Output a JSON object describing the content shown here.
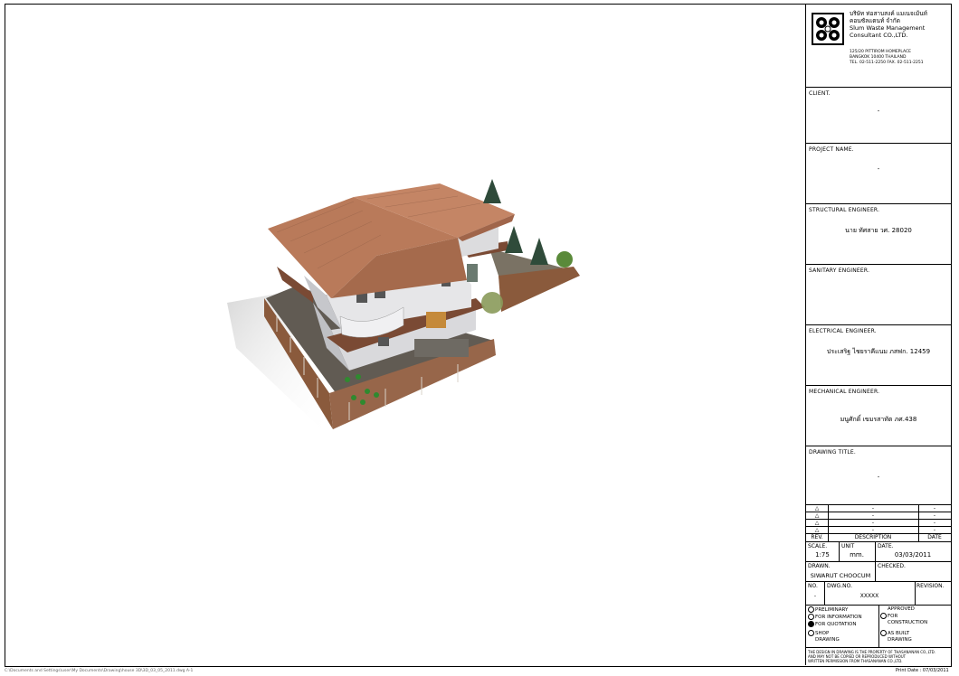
{
  "company": {
    "name_th": "บริษัท ท่อสาบสงค์ แมเนจเม้นท์",
    "name_th2": "คอนซัลแตนท์ จำกัด",
    "name_en1": "Slum Waste Management",
    "name_en2": "Consultant CO.,LTD.",
    "addr1": "125/20 PITTIROM HOMEPLACE",
    "addr2": "BANGKOK 10400 THAILAND",
    "tel": "TEL. 02-511-2250",
    "fax": "FAX. 02-511-2251"
  },
  "client": {
    "label": "CLIENT.",
    "value": "-"
  },
  "project": {
    "label": "PROJECT NAME.",
    "value": "-"
  },
  "structural": {
    "label": "STRUCTURAL ENGINEER.",
    "value": "นาย  ทัศสาย  วศ. 28020"
  },
  "sanitary": {
    "label": "SANITARY ENGINEER.",
    "value": ""
  },
  "electrical": {
    "label": "ELECTRICAL ENGINEER.",
    "value": "ประเสริฐ  ไชยราคีแนม  ภสฟก. 12459"
  },
  "mechanical": {
    "label": "MECHANICAL ENGINEER.",
    "value": "มนูศักดิ์  เขมรสาทัต  ภศ.438"
  },
  "drawing_title": {
    "label": "DRAWING TITLE.",
    "value": "-"
  },
  "revisions": [
    {
      "mark": "△",
      "desc": "-",
      "date": "-"
    },
    {
      "mark": "△",
      "desc": "-",
      "date": "-"
    },
    {
      "mark": "△",
      "desc": "-",
      "date": "-"
    },
    {
      "mark": "△",
      "desc": "-",
      "date": "-"
    }
  ],
  "rev_header": {
    "rev": "REV.",
    "desc": "DESCRIPTION",
    "date": "DATE"
  },
  "scale": {
    "label": "SCALE.",
    "value": "1:75"
  },
  "unit": {
    "label": "UNIT",
    "value": "mm."
  },
  "date": {
    "label": "DATE.",
    "value": "03/03/2011"
  },
  "drawn": {
    "label": "DRAWN.",
    "value": "SIWARUT CHOOCUM"
  },
  "checked": {
    "label": "CHECKED.",
    "value": ""
  },
  "no": {
    "label": "NO.",
    "value": "-"
  },
  "dwg_no": {
    "label": "DWG.NO.",
    "value": "XXXXX"
  },
  "revision": {
    "label": "REVISION.",
    "value": ""
  },
  "status": {
    "preliminary": "PRELIMINARY",
    "for_information": "FOR INFORMATION",
    "for_quotation": "FOR QUOTATION",
    "shop_drawing_1": "SHOP",
    "shop_drawing_2": "DRAWING",
    "approved_1": "APPROVED",
    "approved_2": "FOR",
    "approved_3": "CONSTRUCTION",
    "as_built_1": "AS BUILT",
    "as_built_2": "DRAWING"
  },
  "notice1": "THE DESIGN IN DRAWING IS THE PROPERTY OF THASANANAN CO.,LTD.",
  "notice2": "AND MAY NOT BE COPIED OR REPRODUCED WITHOUT",
  "notice3": "WRITTEN PERMISSION FROM THASANANAN CO.,LTD.",
  "print_date": "Print Date : 07/03/2011",
  "footer_path": "C:\\Documents and Settings\\user\\My Documents\\Drawing\\house 3D\\3D_03_05_2011.dwg  A-1",
  "colors": {
    "roof": "#b97a5a",
    "wall": "#e4e4e6",
    "ground": "#6a645c",
    "fence": "#8a5a3c"
  }
}
